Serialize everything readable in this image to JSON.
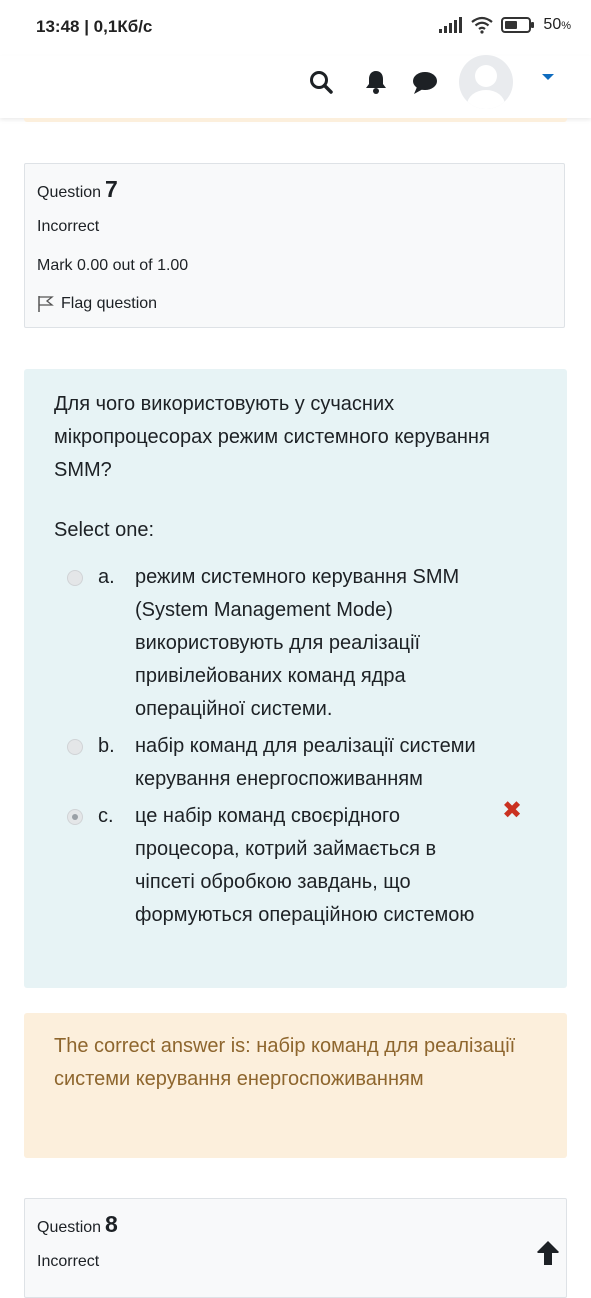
{
  "status_bar": {
    "time": "13:48 | 0,1Кб/с",
    "battery_percent": "50",
    "battery_unit": "%"
  },
  "navbar": {
    "icons": [
      "search-icon",
      "bell-icon",
      "chat-icon",
      "user-avatar",
      "caret-down-icon"
    ]
  },
  "question7": {
    "label": "Question",
    "number": "7",
    "state": "Incorrect",
    "grade": "Mark 0.00 out of 1.00",
    "flag_label": "Flag question",
    "text": "Для чого використовують у сучасних мікропроцесорах режим системного керування SMM?",
    "prompt": "Select one:",
    "options": [
      {
        "letter": "a.",
        "text": "режим системного керування SMM (System Management Mode) використовують для реалізації привілейованих команд ядра операційної системи.",
        "selected": false
      },
      {
        "letter": "b.",
        "text": "набір команд для реалізації системи керування енергоспоживанням",
        "selected": false
      },
      {
        "letter": "c.",
        "text": "це набір команд своєрідного процесора, котрий займається в чіпсеті обробкою завдань, що формуються операційною системою",
        "selected": true
      }
    ],
    "feedback": "The correct answer is: набір команд для реалізації системи керування енергоспоживанням"
  },
  "question8": {
    "label": "Question",
    "number": "8",
    "state": "Incorrect"
  },
  "colors": {
    "incorrect_mark": "#ca3120",
    "feedback_bg": "#fcefdc",
    "feedback_text": "#8e662e",
    "formulation_bg": "#e7f3f5",
    "nav_caret": "#0f6cbf"
  }
}
